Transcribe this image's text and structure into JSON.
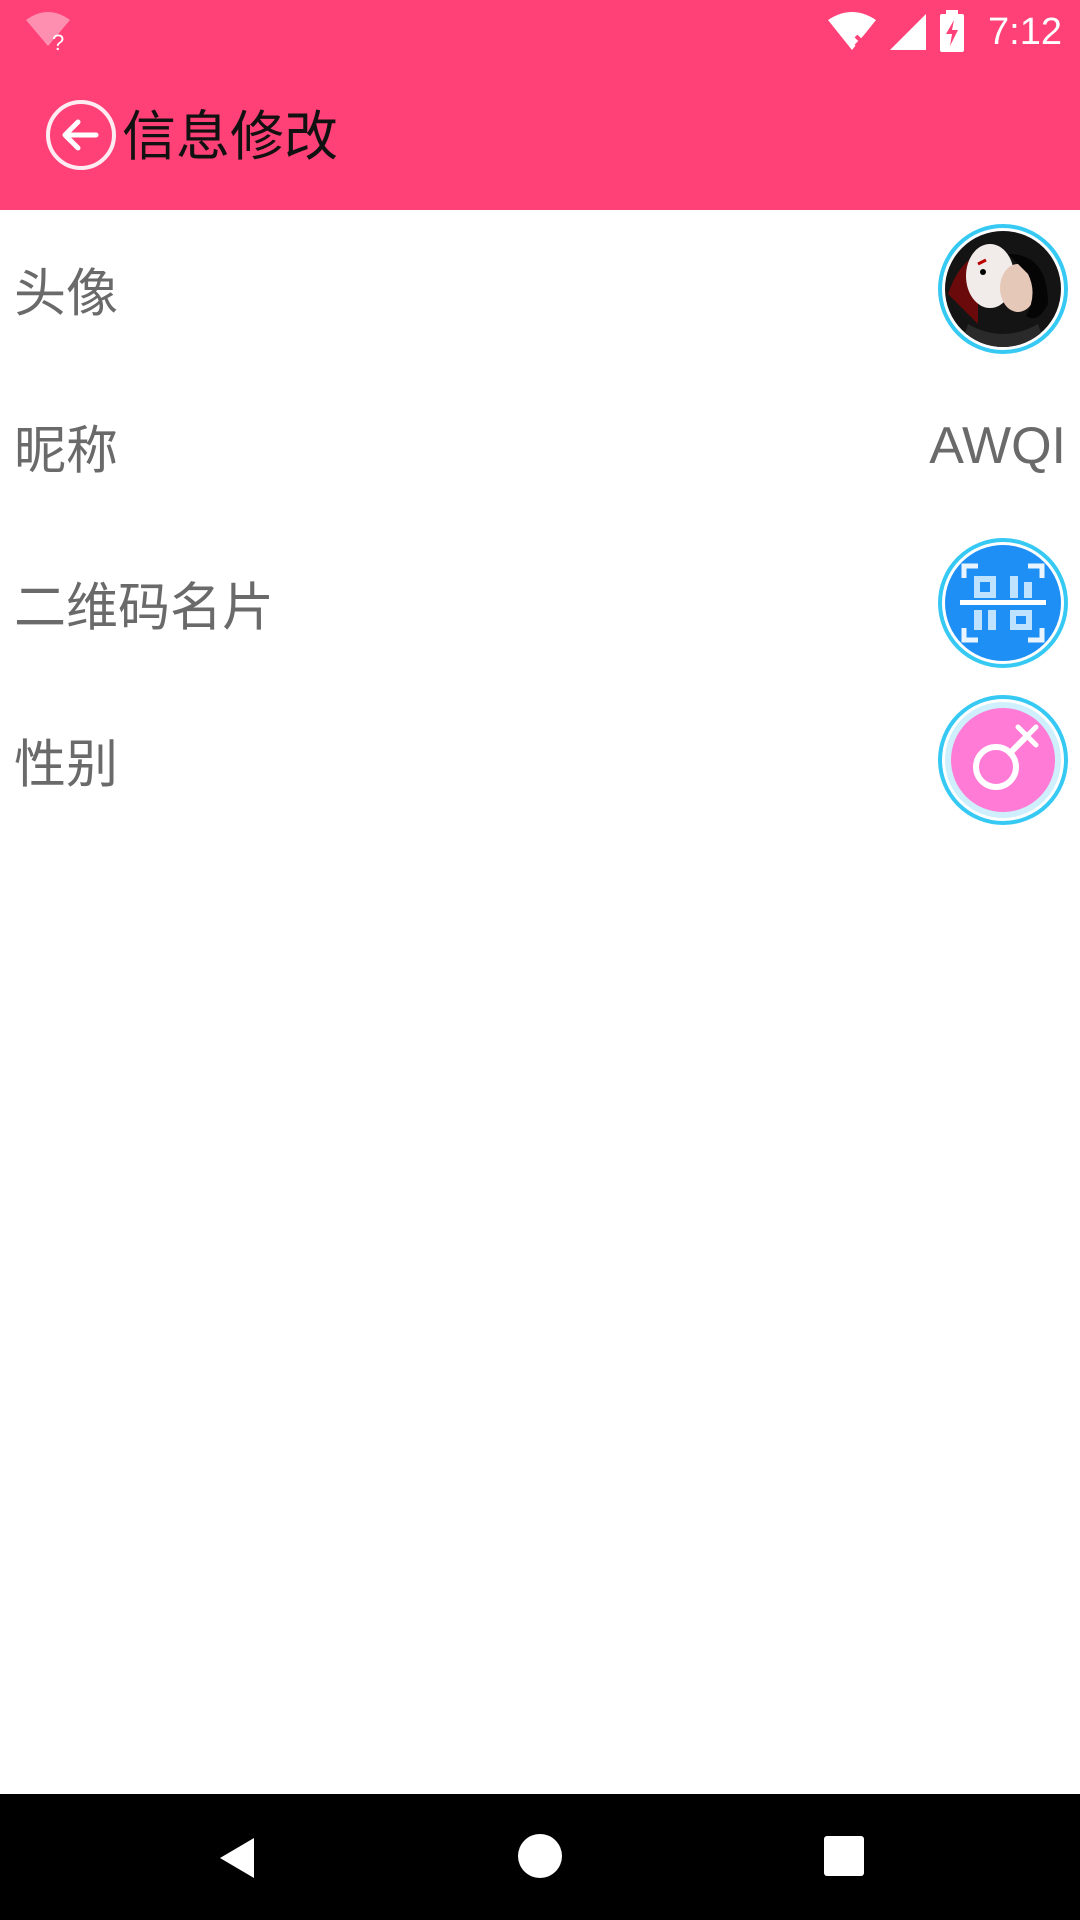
{
  "status_bar": {
    "time": "7:12",
    "left_icon": "wifi-question-icon",
    "right_icons": [
      "wifi-x-icon",
      "signal-icon",
      "battery-charging-icon"
    ]
  },
  "app_bar": {
    "title": "信息修改",
    "back_icon": "back-arrow-circle-icon"
  },
  "rows": [
    {
      "label": "头像",
      "icon": "avatar-photo"
    },
    {
      "label": "昵称",
      "value": "AWQI"
    },
    {
      "label": "二维码名片",
      "icon": "qr-code-scan-icon"
    },
    {
      "label": "性别",
      "icon": "gender-female-icon"
    }
  ],
  "nav_bar": {
    "icons": [
      "nav-back-icon",
      "nav-home-icon",
      "nav-recents-icon"
    ]
  },
  "colors": {
    "primary": "#ff4177",
    "text_label": "#6a6a6a",
    "ring": "#36c9f3",
    "qr_blue": "#1e90f5",
    "gender_pink": "#ff7bd6"
  }
}
